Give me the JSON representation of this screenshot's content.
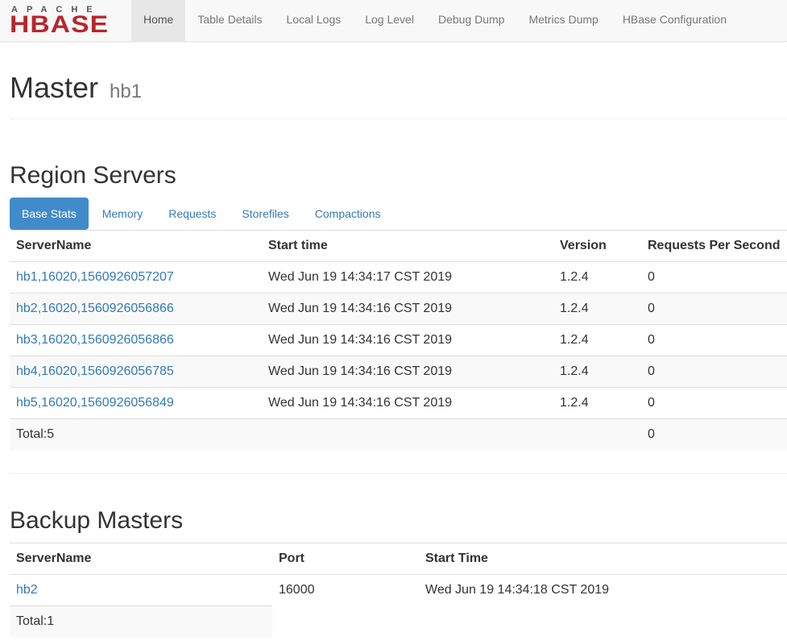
{
  "logo": {
    "top_text": "APACHE",
    "main_text": "HBASE"
  },
  "nav": {
    "items": [
      {
        "label": "Home",
        "active": true
      },
      {
        "label": "Table Details"
      },
      {
        "label": "Local Logs"
      },
      {
        "label": "Log Level"
      },
      {
        "label": "Debug Dump"
      },
      {
        "label": "Metrics Dump"
      },
      {
        "label": "HBase Configuration"
      }
    ]
  },
  "page": {
    "title": "Master",
    "subtitle": "hb1"
  },
  "region_servers": {
    "title": "Region Servers",
    "tabs": [
      "Base Stats",
      "Memory",
      "Requests",
      "Storefiles",
      "Compactions"
    ],
    "columns": [
      "ServerName",
      "Start time",
      "Version",
      "Requests Per Second"
    ],
    "rows": [
      {
        "server": "hb1,16020,1560926057207",
        "start": "Wed Jun 19 14:34:17 CST 2019",
        "version": "1.2.4",
        "rps": "0"
      },
      {
        "server": "hb2,16020,1560926056866",
        "start": "Wed Jun 19 14:34:16 CST 2019",
        "version": "1.2.4",
        "rps": "0"
      },
      {
        "server": "hb3,16020,1560926056866",
        "start": "Wed Jun 19 14:34:16 CST 2019",
        "version": "1.2.4",
        "rps": "0"
      },
      {
        "server": "hb4,16020,1560926056785",
        "start": "Wed Jun 19 14:34:16 CST 2019",
        "version": "1.2.4",
        "rps": "0"
      },
      {
        "server": "hb5,16020,1560926056849",
        "start": "Wed Jun 19 14:34:16 CST 2019",
        "version": "1.2.4",
        "rps": "0"
      }
    ],
    "total_label": "Total:5",
    "total_rps": "0"
  },
  "backup_masters": {
    "title": "Backup Masters",
    "columns": [
      "ServerName",
      "Port",
      "Start Time"
    ],
    "rows": [
      {
        "server": "hb2",
        "port": "16000",
        "start": "Wed Jun 19 14:34:18 CST 2019"
      }
    ],
    "total_label": "Total:1"
  }
}
